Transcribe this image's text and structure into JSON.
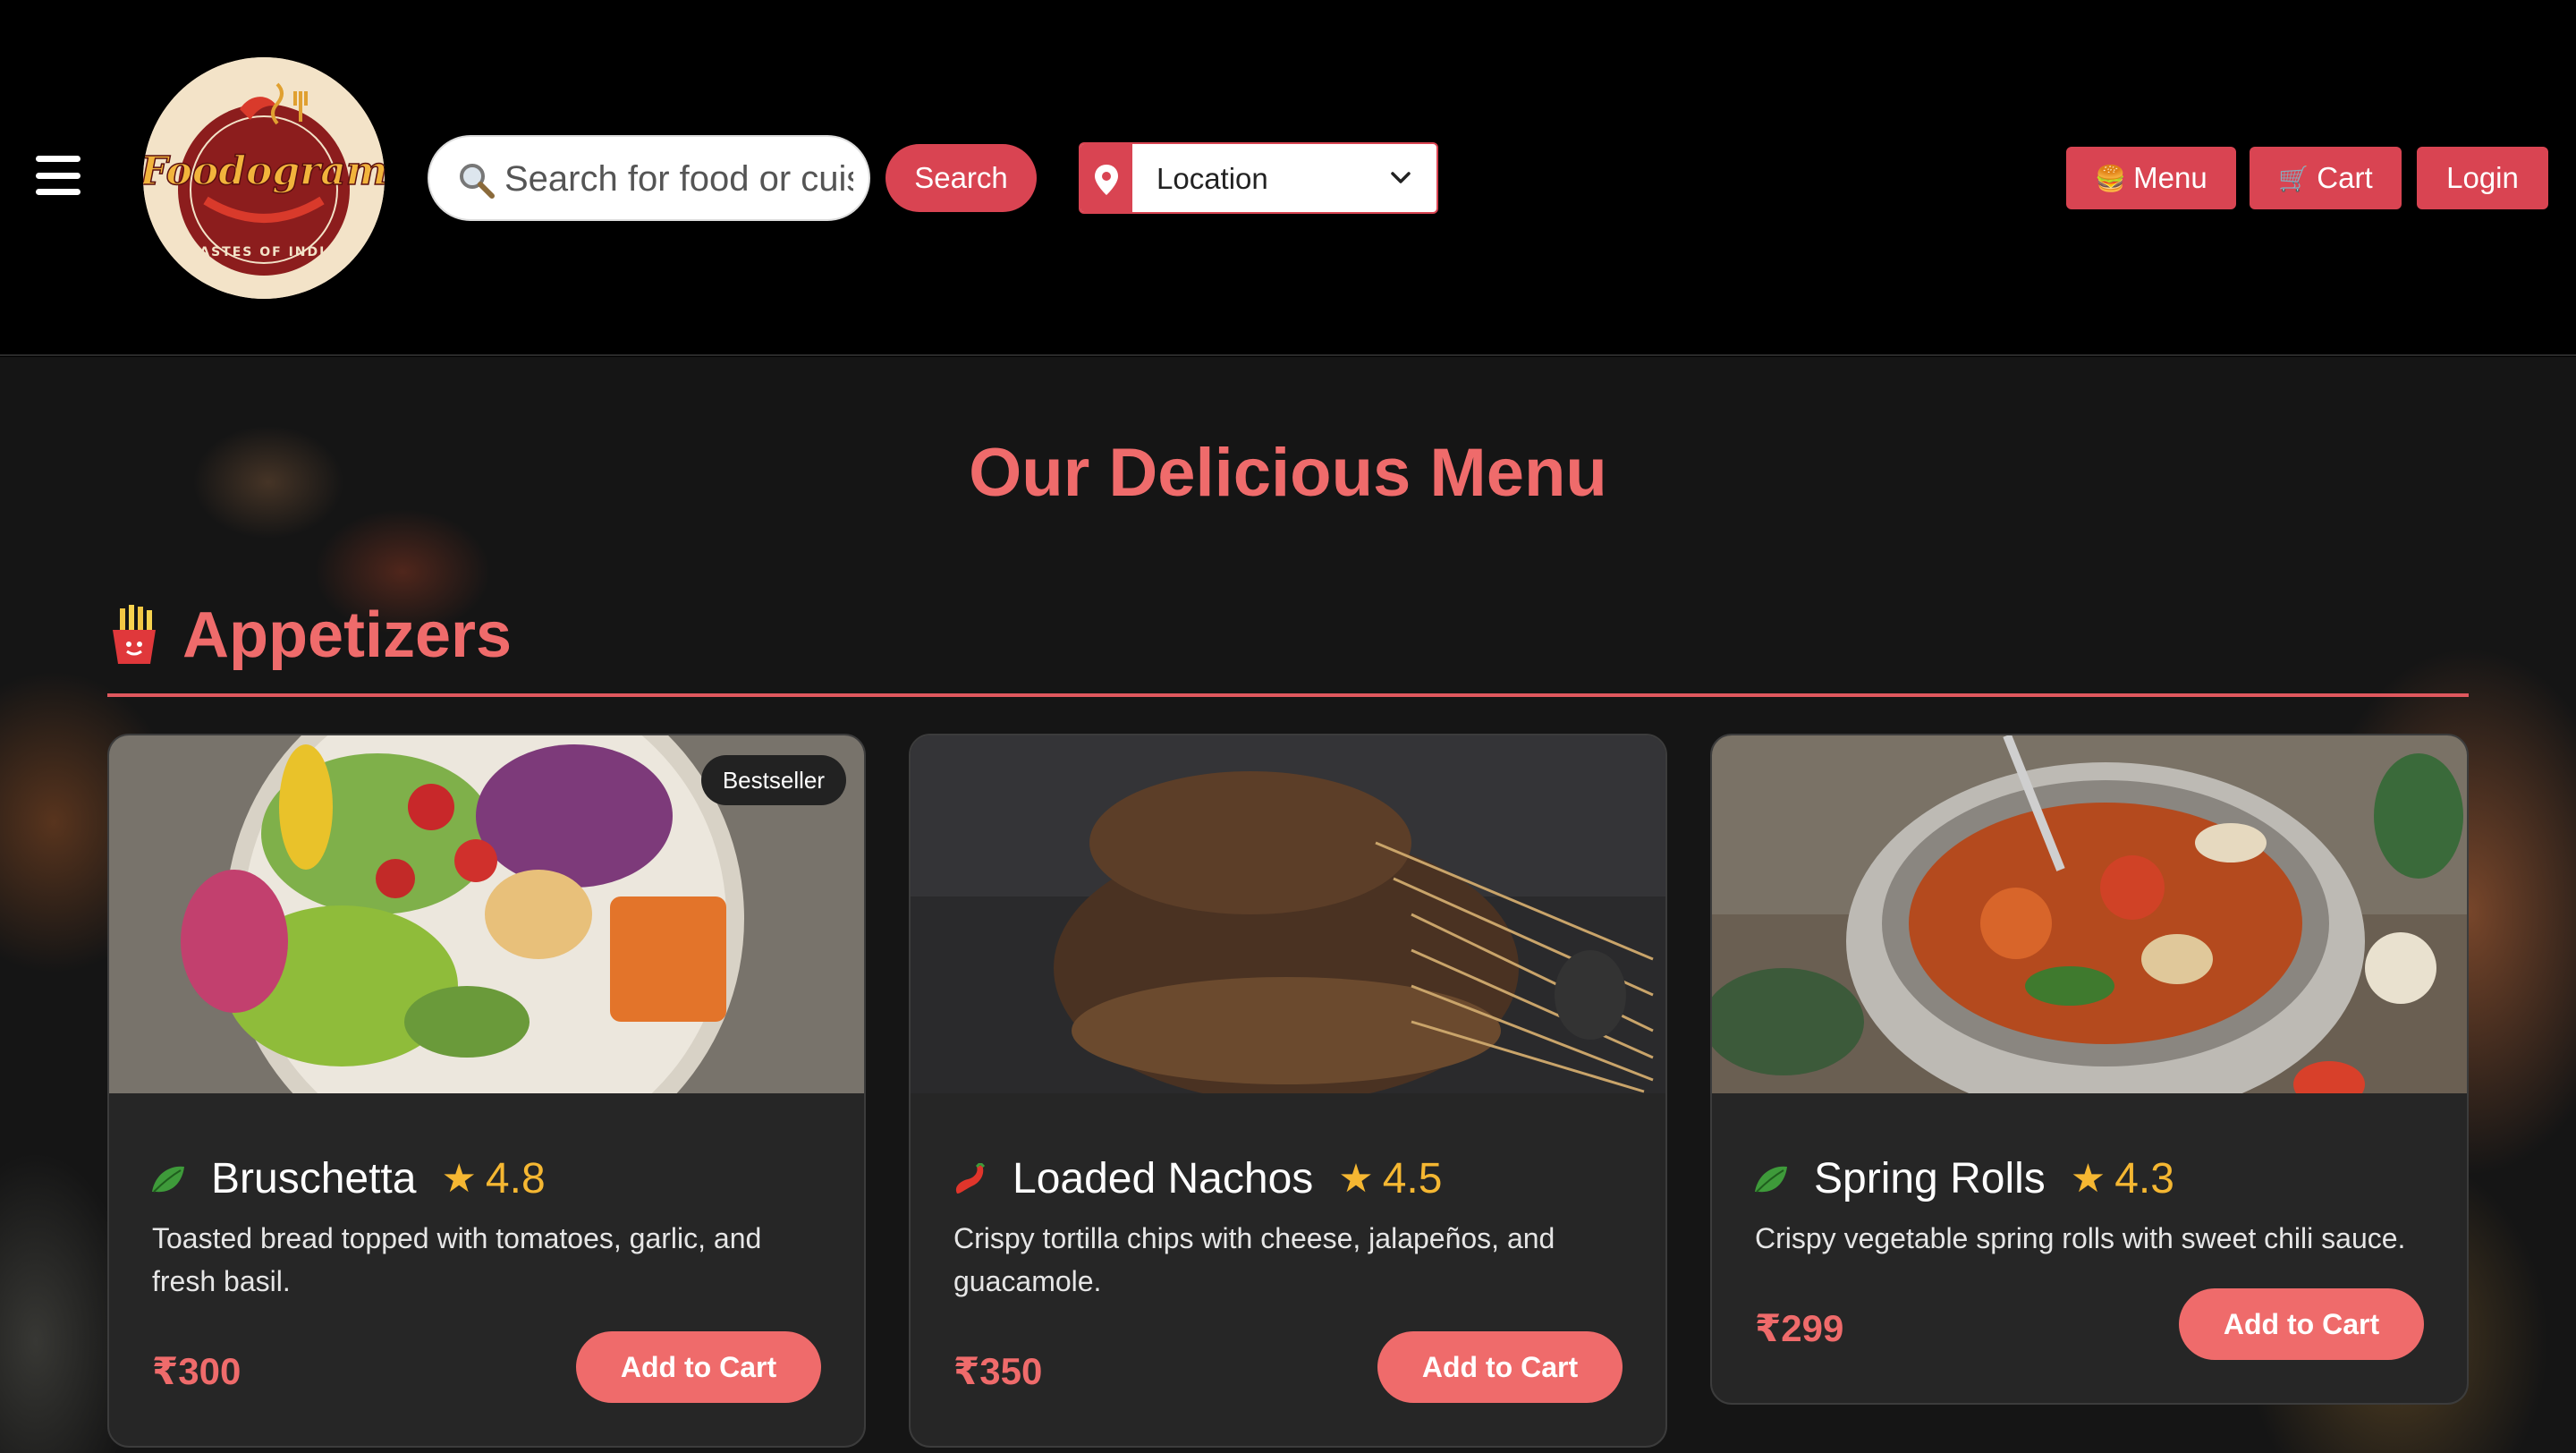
{
  "header": {
    "logo": {
      "brand": "Foodogram",
      "tagline": "TASTES OF INDIA"
    },
    "search": {
      "placeholder": "Search for food or cuisine",
      "button_label": "Search"
    },
    "location": {
      "label": "Location"
    },
    "nav": [
      {
        "label": "Menu",
        "emoji": "🍔"
      },
      {
        "label": "Cart",
        "emoji": "🛒"
      },
      {
        "label": "Login"
      }
    ]
  },
  "main": {
    "title": "Our Delicious Menu",
    "section": {
      "title": "Appetizers",
      "icon": "fries-icon"
    },
    "items": [
      {
        "name": "Bruschetta",
        "rating": "4.8",
        "diet": "veg",
        "badge": "Bestseller",
        "description": "Toasted bread topped with tomatoes, garlic, and fresh basil.",
        "price": "₹300",
        "button": "Add to Cart"
      },
      {
        "name": "Loaded Nachos",
        "rating": "4.5",
        "diet": "spicy",
        "description": "Crispy tortilla chips with cheese, jalapeños, and guacamole.",
        "price": "₹350",
        "button": "Add to Cart"
      },
      {
        "name": "Spring Rolls",
        "rating": "4.3",
        "diet": "veg",
        "description": "Crispy vegetable spring rolls with sweet chili sauce.",
        "price": "₹299",
        "button": "Add to Cart"
      }
    ]
  },
  "colors": {
    "accent": "#d94452",
    "title": "#ef6b6b",
    "star": "#f5b732",
    "veg": "#3e9a3a"
  }
}
